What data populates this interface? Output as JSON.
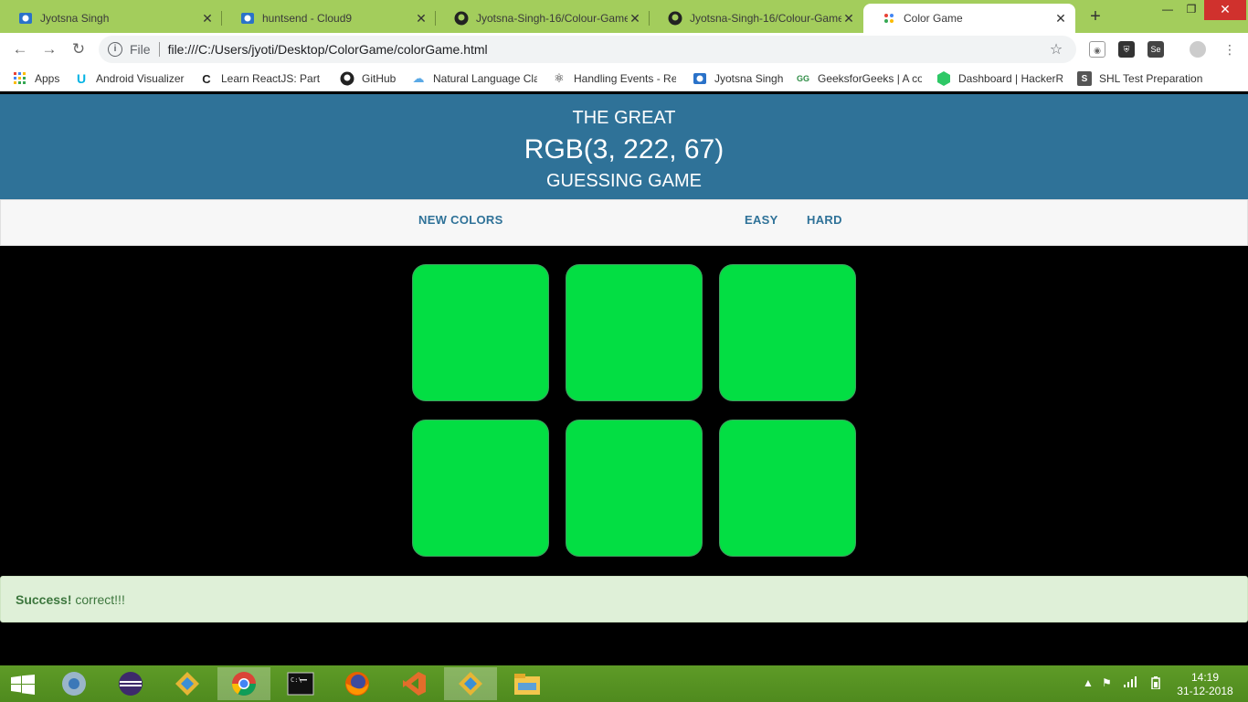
{
  "tabs": [
    {
      "title": "Jyotsna Singh",
      "icon": "cloud9-icon"
    },
    {
      "title": "huntsend - Cloud9",
      "icon": "cloud9-icon"
    },
    {
      "title": "Jyotsna-Singh-16/Colour-Game",
      "icon": "github-icon"
    },
    {
      "title": "Jyotsna-Singh-16/Colour-Game",
      "icon": "github-icon"
    },
    {
      "title": "Color Game",
      "icon": "colorgame-icon",
      "active": true
    }
  ],
  "toolbar": {
    "scheme": "File",
    "url": "file:///C:/Users/jyoti/Desktop/ColorGame/colorGame.html"
  },
  "bookmarks": [
    {
      "label": "Apps",
      "icon": "apps-grid-icon"
    },
    {
      "label": "Android Visualizer",
      "icon": "udacity-icon"
    },
    {
      "label": "Learn ReactJS: Part I |",
      "icon": "course-icon"
    },
    {
      "label": "GitHub",
      "icon": "github-icon"
    },
    {
      "label": "Natural Language Cla",
      "icon": "cloud-icon"
    },
    {
      "label": "Handling Events - Re",
      "icon": "react-icon"
    },
    {
      "label": "Jyotsna Singh",
      "icon": "cloud9-icon"
    },
    {
      "label": "GeeksforGeeks | A co",
      "icon": "geeksforgeeks-icon"
    },
    {
      "label": "Dashboard | HackerR",
      "icon": "hackerrank-icon"
    },
    {
      "label": "SHL Test Preparation",
      "icon": "shl-icon"
    }
  ],
  "game": {
    "title_top": "THE GREAT",
    "rgb": "RGB(3, 222, 67)",
    "title_bottom": "GUESSING GAME",
    "new_colors": "NEW COLORS",
    "easy": "EASY",
    "hard": "HARD",
    "square_color": "#03de43",
    "alert_strong": "Success!",
    "alert_text": " correct!!!"
  },
  "taskbar": {
    "time": "14:19",
    "date": "31-12-2018"
  },
  "colors": {
    "tabstrip": "#a3cd5c",
    "header": "#2f7298",
    "success_bg": "#dff0d8",
    "success_text": "#3c763d",
    "taskbar": "#5e9b27"
  }
}
